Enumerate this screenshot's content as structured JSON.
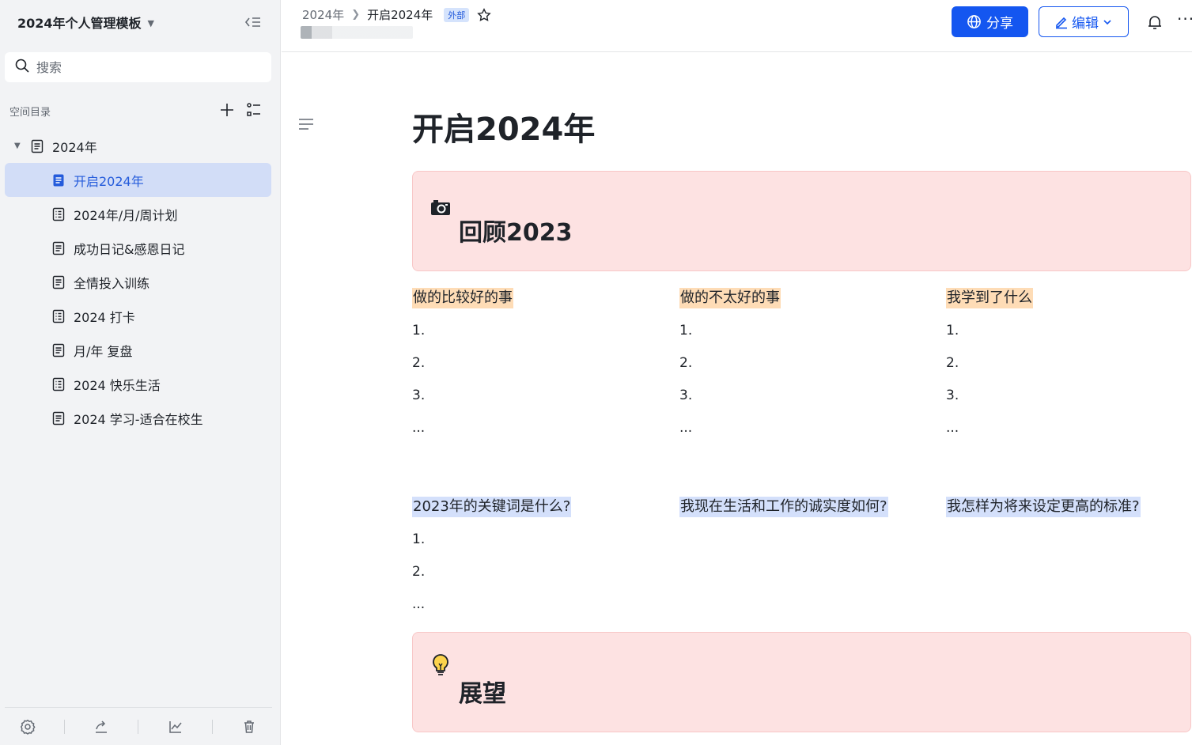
{
  "sidebar": {
    "space_title": "2024年个人管理模板",
    "search_placeholder": "搜索",
    "directory_label": "空间目录",
    "tree": {
      "root": "2024年",
      "children": [
        "开启2024年",
        "2024年/月/周计划",
        "成功日记&感恩日记",
        "全情投入训练",
        "2024 打卡",
        "月/年 复盘",
        "2024 快乐生活",
        "2024 学习-适合在校生"
      ]
    }
  },
  "header": {
    "breadcrumb_parent": "2024年",
    "breadcrumb_current": "开启2024年",
    "badge": "外部",
    "share_label": "分享",
    "edit_label": "编辑",
    "more": "···"
  },
  "doc": {
    "title": "开启2024年",
    "section1": {
      "heading": "回顾2023",
      "columns": [
        {
          "label": "做的比较好的事",
          "items": [
            "1.",
            "2.",
            "3.",
            "..."
          ]
        },
        {
          "label": "做的不太好的事",
          "items": [
            "1.",
            "2.",
            "3.",
            "..."
          ]
        },
        {
          "label": "我学到了什么",
          "items": [
            "1.",
            "2.",
            "3.",
            "..."
          ]
        }
      ],
      "questions": [
        {
          "label": "2023年的关键词是什么?",
          "items": [
            "1.",
            "2.",
            "..."
          ]
        },
        {
          "label": "我现在生活和工作的诚实度如何?"
        },
        {
          "label": "我怎样为将来设定更高的标准?"
        }
      ]
    },
    "section2": {
      "heading": "展望"
    }
  },
  "colors": {
    "accent": "#1456f0",
    "callout_bg": "#fde2e2",
    "highlight_orange": "#fedcb6",
    "highlight_blue": "#d4e0fb",
    "active_item": "#d2ddf7"
  }
}
